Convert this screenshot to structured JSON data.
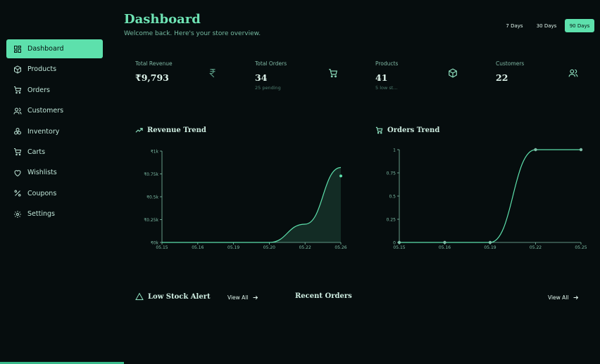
{
  "sidebar": {
    "items": [
      {
        "label": "Dashboard",
        "icon": "dashboard-icon",
        "active": true
      },
      {
        "label": "Products",
        "icon": "box-icon"
      },
      {
        "label": "Orders",
        "icon": "cart-icon"
      },
      {
        "label": "Customers",
        "icon": "users-icon"
      },
      {
        "label": "Inventory",
        "icon": "boxes-icon"
      },
      {
        "label": "Carts",
        "icon": "cart-icon"
      },
      {
        "label": "Wishlists",
        "icon": "heart-icon"
      },
      {
        "label": "Coupons",
        "icon": "percent-icon"
      },
      {
        "label": "Settings",
        "icon": "gear-icon"
      }
    ]
  },
  "header": {
    "title": "Dashboard",
    "subtitle": "Welcome back. Here's your store overview.",
    "ranges": [
      {
        "label": "7 Days"
      },
      {
        "label": "30 Days"
      },
      {
        "label": "90 Days",
        "active": true
      }
    ]
  },
  "stats": [
    {
      "label": "Total Revenue",
      "value": "₹9,793",
      "sub": "",
      "icon": "rupee-icon"
    },
    {
      "label": "Total Orders",
      "value": "34",
      "sub": "25 pending",
      "icon": "cart-icon"
    },
    {
      "label": "Products",
      "value": "41",
      "sub": "5 low st...",
      "icon": "box-icon"
    },
    {
      "label": "Customers",
      "value": "22",
      "sub": "",
      "icon": "users-icon"
    }
  ],
  "chart_data": [
    {
      "type": "area",
      "title": "Revenue Trend",
      "x": [
        "05.15",
        "05.16",
        "05.19",
        "05.20",
        "05.22",
        "05.26"
      ],
      "y_ticks": [
        "₹0k",
        "₹0.25k",
        "₹0.5k",
        "₹0.75k",
        "₹1k"
      ],
      "ylim": [
        0,
        1
      ],
      "series": [
        {
          "values": [
            0,
            0,
            0,
            0,
            0.2,
            0.82
          ]
        }
      ],
      "color": "#5de0ac"
    },
    {
      "type": "line",
      "title": "Orders Trend",
      "x": [
        "05.15",
        "05.16",
        "05.19",
        "05.22",
        "05.25"
      ],
      "y_ticks": [
        "0",
        "0.25",
        "0.5",
        "0.75",
        "1"
      ],
      "ylim": [
        0,
        1
      ],
      "series": [
        {
          "values": [
            0,
            0,
            0,
            1,
            1
          ]
        }
      ],
      "color": "#5de0ac"
    }
  ],
  "sections": {
    "low_stock": {
      "title": "Low Stock Alert",
      "view_all": "View All"
    },
    "recent_orders": {
      "title": "Recent Orders",
      "view_all": "View All"
    }
  },
  "colors": {
    "accent": "#5de0ac",
    "background": "#060d0e"
  }
}
